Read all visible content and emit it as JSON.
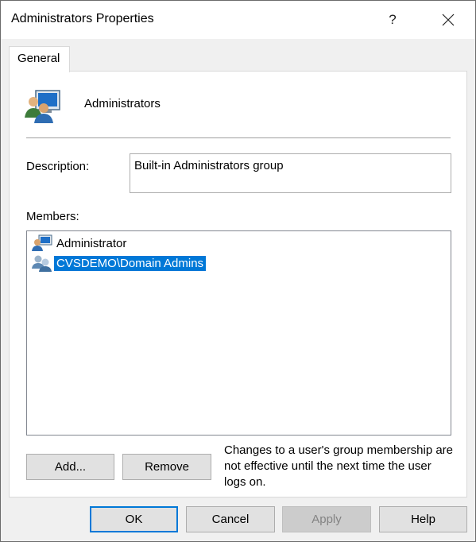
{
  "window": {
    "title": "Administrators Properties",
    "help_label": "?"
  },
  "tabs": [
    {
      "label": "General"
    }
  ],
  "group": {
    "name": "Administrators",
    "icon": "group-users-icon"
  },
  "description": {
    "label": "Description:",
    "value": "Built-in Administrators group"
  },
  "members": {
    "label": "Members:",
    "items": [
      {
        "name": "Administrator",
        "icon": "user-computer-icon",
        "selected": false
      },
      {
        "name": "CVSDEMO\\Domain Admins",
        "icon": "domain-group-icon",
        "selected": true
      }
    ]
  },
  "member_actions": {
    "add_label": "Add...",
    "remove_label": "Remove"
  },
  "note": "Changes to a user's group membership are not effective until the next time the user logs on.",
  "footer": {
    "ok_label": "OK",
    "cancel_label": "Cancel",
    "apply_label": "Apply",
    "help_label": "Help"
  },
  "colors": {
    "selection": "#0078d7",
    "dialog_bg": "#f0f0f0"
  }
}
